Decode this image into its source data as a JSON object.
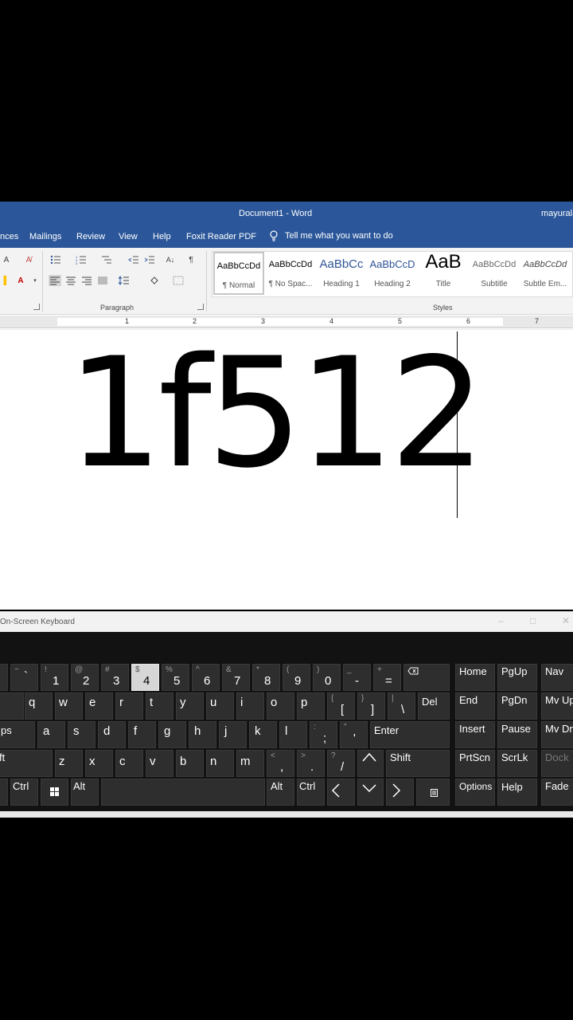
{
  "word": {
    "document_title": "Document1  -  Word",
    "user": "mayurala",
    "menu_tabs": [
      "nces",
      "Mailings",
      "Review",
      "View",
      "Help",
      "Foxit Reader PDF"
    ],
    "tell_me": "Tell me what you want to do",
    "groups": {
      "paragraph": "Paragraph",
      "styles": "Styles"
    },
    "styles": [
      {
        "sample": "AaBbCcDd",
        "name": "¶ Normal"
      },
      {
        "sample": "AaBbCcDd",
        "name": "¶ No Spac..."
      },
      {
        "sample": "AaBbCc",
        "name": "Heading 1"
      },
      {
        "sample": "AaBbCcD",
        "name": "Heading 2"
      },
      {
        "sample": "AaB",
        "name": "Title"
      },
      {
        "sample": "AaBbCcDd",
        "name": "Subtitle"
      },
      {
        "sample": "AaBbCcDd",
        "name": "Subtle Em..."
      }
    ],
    "ruler_numbers": [
      "1",
      "2",
      "3",
      "4",
      "5",
      "6",
      "7"
    ],
    "document_text": "1f512",
    "accent_color": "#2b579a"
  },
  "osk": {
    "title": "On-Screen Keyboard",
    "window_controls": [
      "–",
      "□",
      "✕"
    ],
    "pressed_key": "4",
    "number_row": [
      {
        "main": "`",
        "shift": "~"
      },
      {
        "main": "1",
        "shift": "!"
      },
      {
        "main": "2",
        "shift": "@"
      },
      {
        "main": "3",
        "shift": "#"
      },
      {
        "main": "4",
        "shift": "$"
      },
      {
        "main": "5",
        "shift": "%"
      },
      {
        "main": "6",
        "shift": "^"
      },
      {
        "main": "7",
        "shift": "&"
      },
      {
        "main": "8",
        "shift": "*"
      },
      {
        "main": "9",
        "shift": "("
      },
      {
        "main": "0",
        "shift": ")"
      },
      {
        "main": "-",
        "shift": "_"
      },
      {
        "main": "=",
        "shift": "+"
      }
    ],
    "backspace_icon": "backspace-icon",
    "qwerty_row": [
      "q",
      "w",
      "e",
      "r",
      "t",
      "y",
      "u",
      "i",
      "o",
      "p"
    ],
    "bracket_keys": [
      {
        "main": "[",
        "shift": "{"
      },
      {
        "main": "]",
        "shift": "}"
      },
      {
        "main": "\\",
        "shift": "|"
      }
    ],
    "home_row": [
      "a",
      "s",
      "d",
      "f",
      "g",
      "h",
      "j",
      "k",
      "l"
    ],
    "home_punct": [
      {
        "main": ";",
        "shift": ":"
      },
      {
        "main": "'",
        "shift": "\""
      }
    ],
    "bottom_letters": [
      "z",
      "x",
      "c",
      "v",
      "b",
      "n",
      "m"
    ],
    "bottom_punct": [
      {
        "main": ",",
        "shift": "<"
      },
      {
        "main": ".",
        "shift": ">"
      },
      {
        "main": "/",
        "shift": "?"
      }
    ],
    "labels": {
      "tab": "",
      "caps": "ps",
      "shift_left": "ft",
      "del": "Del",
      "enter": "Enter",
      "shift_right": "Shift",
      "ctrl": "Ctrl",
      "alt": "Alt",
      "alt_right": "Alt",
      "ctrl_right": "Ctrl",
      "home": "Home",
      "pgup": "PgUp",
      "nav": "Nav",
      "end": "End",
      "pgdn": "PgDn",
      "mvup": "Mv Up",
      "insert": "Insert",
      "pause": "Pause",
      "mvdn": "Mv Dn",
      "prtscn": "PrtScn",
      "scrlk": "ScrLk",
      "dock": "Dock",
      "options": "Options",
      "help": "Help",
      "fade": "Fade"
    }
  }
}
